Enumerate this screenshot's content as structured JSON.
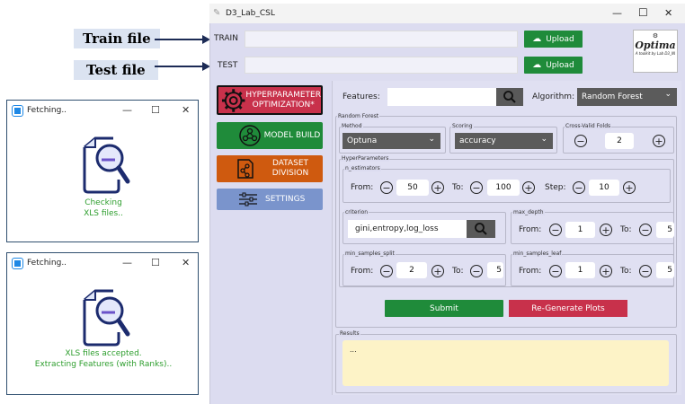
{
  "annotations": {
    "train_label": "Train file",
    "test_label": "Test file"
  },
  "popup1": {
    "title": "Fetching..",
    "line1": "Checking",
    "line2": "XLS files.."
  },
  "popup2": {
    "title": "Fetching..",
    "line1": "XLS files accepted.",
    "line2": "Extracting Features (with Ranks).."
  },
  "window": {
    "title": "D3_Lab_CSL",
    "minimize": "—",
    "maximize": "☐",
    "close": "✕"
  },
  "files": {
    "train_label": "TRAIN",
    "test_label": "TEST",
    "upload_label": "Upload",
    "train_value": "",
    "test_value": ""
  },
  "logo": {
    "name": "Optima",
    "tagline": "A toolkit by Lab D3_IN"
  },
  "nav": [
    {
      "label": "HYPERPARAMETER OPTIMIZATION*",
      "color": "#c8314b"
    },
    {
      "label": "MODEL BUILD",
      "color": "#1f8b3a"
    },
    {
      "label": "DATASET DIVISION",
      "color": "#cf5a0f"
    },
    {
      "label": "SETTINGS",
      "color": "#7a94cc"
    }
  ],
  "features": {
    "label": "Features:",
    "value": ""
  },
  "algorithm": {
    "label": "Algorithm:",
    "value": "Random Forest"
  },
  "rf": {
    "group_title": "Random Forest",
    "method_title": "Method",
    "method_value": "Optuna",
    "scoring_title": "Scoring",
    "scoring_value": "accuracy",
    "folds_title": "Cross-Valid Folds",
    "folds_value": "2"
  },
  "hyper": {
    "group_title": "HyperParameters",
    "n_estimators": {
      "title": "n_estimators",
      "from_label": "From:",
      "from": "50",
      "to_label": "To:",
      "to": "100",
      "step_label": "Step:",
      "step": "10"
    },
    "criterion": {
      "title": "criterion",
      "value": "gini,entropy,log_loss"
    },
    "max_depth": {
      "title": "max_depth",
      "from_label": "From:",
      "from": "1",
      "to_label": "To:",
      "to": "5"
    },
    "min_samples_split": {
      "title": "min_samples_split",
      "from_label": "From:",
      "from": "2",
      "to_label": "To:",
      "to": "5"
    },
    "min_samples_leaf": {
      "title": "min_samples_leaf",
      "from_label": "From:",
      "from": "1",
      "to_label": "To:",
      "to": "5"
    }
  },
  "actions": {
    "submit": "Submit",
    "regenerate": "Re-Generate Plots"
  },
  "results": {
    "title": "Results",
    "text": "..."
  }
}
